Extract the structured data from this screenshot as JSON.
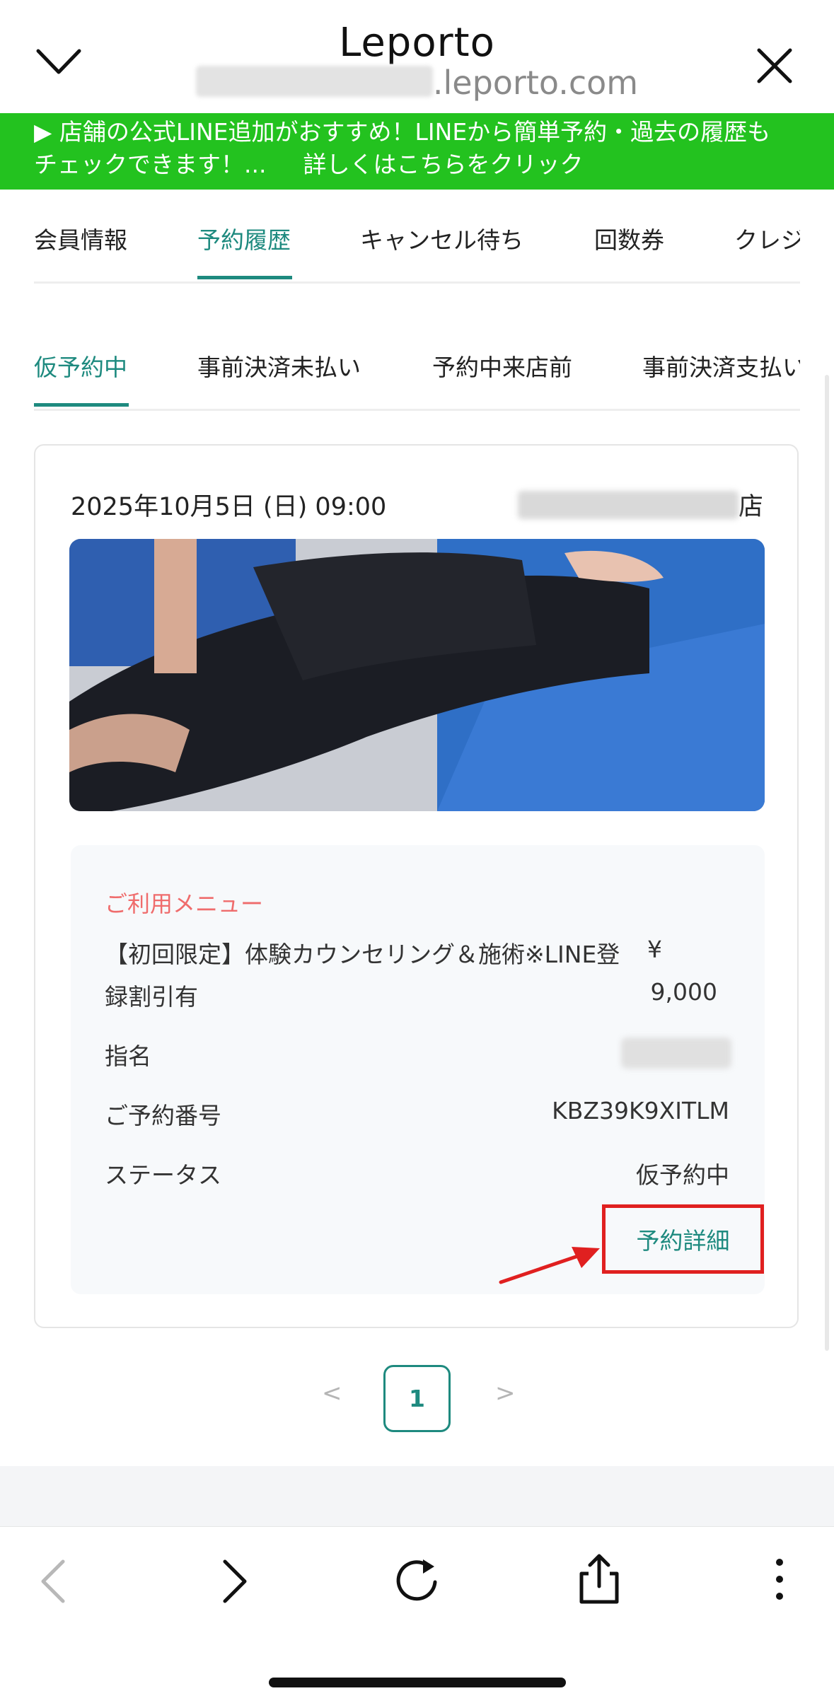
{
  "header": {
    "title": "Leporto",
    "url_domain": ".leporto.com"
  },
  "banner": {
    "line1": "▶ 店舗の公式LINE追加がおすすめ！LINEから簡単予約・過去の履歴も",
    "line2_text": "チェックできます！...",
    "line2_link": "詳しくはこちらをクリック"
  },
  "main_tabs": [
    {
      "label": "会員情報"
    },
    {
      "label": "予約履歴",
      "active": true
    },
    {
      "label": "キャンセル待ち"
    },
    {
      "label": "回数券"
    },
    {
      "label": "クレジ"
    }
  ],
  "sub_tabs": [
    {
      "label": "仮予約中",
      "active": true
    },
    {
      "label": "事前決済未払い"
    },
    {
      "label": "予約中来店前"
    },
    {
      "label": "事前決済支払い"
    }
  ],
  "reservation": {
    "datetime": "2025年10月5日 (日) 09:00",
    "shop_suffix": "店",
    "menu_label": "ご利用メニュー",
    "menu_name_line1": "【初回限定】体験カウンセリング＆施術※LINE登",
    "menu_name_line2": "録割引有",
    "price_symbol": "¥",
    "price_value": "9,000",
    "shimei_label": "指名",
    "reservation_no_label": "ご予約番号",
    "reservation_no": "KBZ39K9XITLM",
    "status_label": "ステータス",
    "status_value": "仮予約中",
    "detail_button": "予約詳細"
  },
  "pagination": {
    "prev": "<",
    "current": "1",
    "next": ">"
  },
  "colors": {
    "accent": "#1e8a7f",
    "line_green": "#23c21f",
    "highlight_red": "#e02020",
    "menu_label": "#ef6c6c"
  },
  "icons": [
    "chevron-down-icon",
    "close-icon",
    "back-arrow-icon",
    "forward-arrow-icon",
    "reload-icon",
    "share-icon",
    "more-vertical-icon"
  ]
}
